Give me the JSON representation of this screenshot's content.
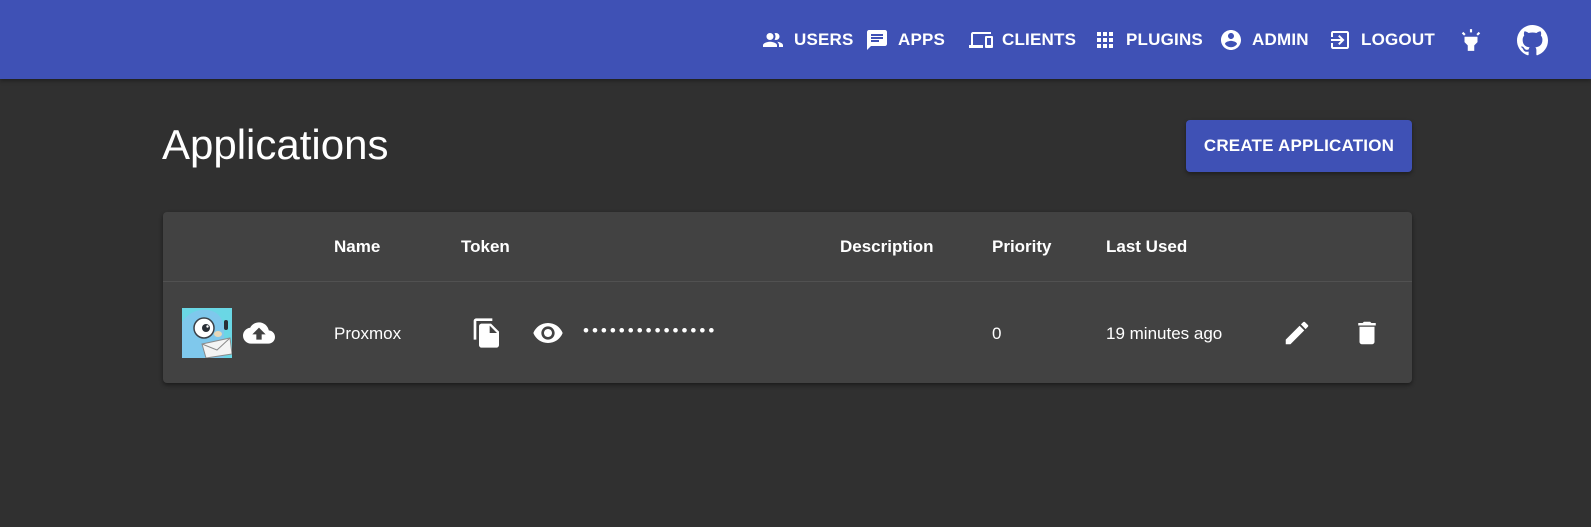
{
  "nav": {
    "items": [
      {
        "label": "USERS",
        "icon": "users-icon"
      },
      {
        "label": "APPS",
        "icon": "chat-icon"
      },
      {
        "label": "CLIENTS",
        "icon": "devices-icon"
      },
      {
        "label": "PLUGINS",
        "icon": "apps-grid-icon"
      },
      {
        "label": "ADMIN",
        "icon": "account-circle-icon"
      },
      {
        "label": "LOGOUT",
        "icon": "exit-icon"
      }
    ],
    "theme_toggle_icon": "lightbulb-icon",
    "github_icon": "github-icon"
  },
  "page": {
    "title": "Applications",
    "create_button_label": "CREATE APPLICATION"
  },
  "table": {
    "headers": {
      "name": "Name",
      "token": "Token",
      "description": "Description",
      "priority": "Priority",
      "last_used": "Last Used"
    },
    "rows": [
      {
        "image_icon": "gopher-app-image",
        "upload_icon": "cloud-upload-icon",
        "name": "Proxmox",
        "copy_icon": "copy-icon",
        "visibility_icon": "eye-icon",
        "token_masked": "•••••••••••••••",
        "description": "",
        "priority": "0",
        "last_used": "19 minutes ago",
        "edit_icon": "pencil-icon",
        "delete_icon": "trash-icon"
      }
    ]
  },
  "colors": {
    "primary": "#3f51b5",
    "background": "#303030",
    "surface": "#424242"
  }
}
